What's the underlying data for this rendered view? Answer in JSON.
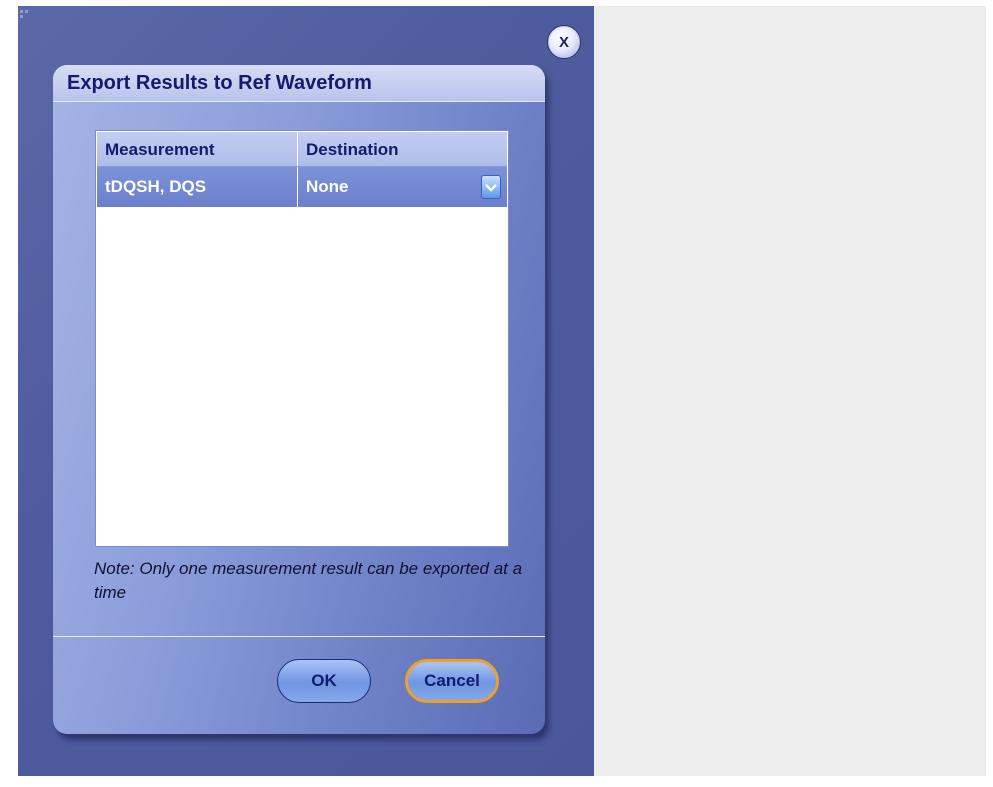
{
  "window": {
    "close_label": "X"
  },
  "dialog": {
    "title": "Export Results to Ref Waveform",
    "table": {
      "columns": [
        "Measurement",
        "Destination"
      ],
      "rows": [
        {
          "measurement": "tDQSH, DQS",
          "destination": "None"
        }
      ]
    },
    "note": "Note: Only one measurement result can be exported at a time",
    "buttons": {
      "ok": "OK",
      "cancel": "Cancel"
    }
  },
  "icons": {
    "close": "close-icon",
    "dropdown": "chevron-down-icon",
    "grip": "resize-grip-icon"
  },
  "colors": {
    "window_bg": "#4e5c9e",
    "dialog_title": "#141b6e",
    "selected_row": "#7188d4",
    "focus_ring": "#f0a028"
  }
}
